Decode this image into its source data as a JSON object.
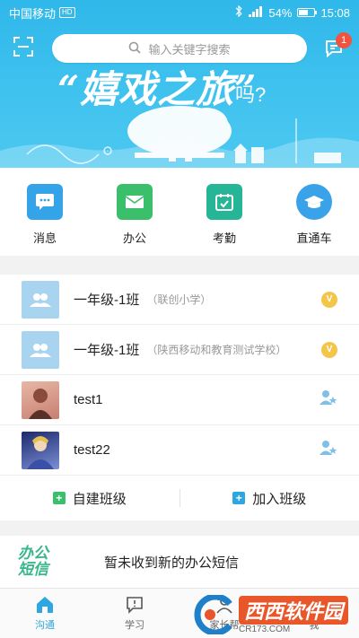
{
  "status_bar": {
    "carrier": "中国移动",
    "hd": "HD",
    "battery": "54%",
    "time": "15:08"
  },
  "header": {
    "search_placeholder": "输入关键字搜索",
    "message_badge": "1"
  },
  "banner": {
    "title": "“嬉戏之旅”",
    "suffix": "吗?"
  },
  "quick_actions": [
    {
      "label": "消息",
      "icon": "chat-icon",
      "color": "#35a3e8"
    },
    {
      "label": "办公",
      "icon": "mail-icon",
      "color": "#3bbf6a"
    },
    {
      "label": "考勤",
      "icon": "calendar-check-icon",
      "color": "#26b597"
    },
    {
      "label": "直通车",
      "icon": "graduation-cap-icon",
      "color": "#3aa2e8"
    }
  ],
  "classes": [
    {
      "name": "一年级-1班",
      "school": "（联创小学）",
      "badge": "V"
    },
    {
      "name": "一年级-1班",
      "school": "（陕西移动和教育测试学校）",
      "badge": "V"
    }
  ],
  "contacts": [
    {
      "name": "test1"
    },
    {
      "name": "test22"
    }
  ],
  "class_actions": {
    "create": "自建班级",
    "join": "加入班级"
  },
  "sms": {
    "logo_line1": "办公",
    "logo_line2": "短信",
    "message": "暂未收到新的办公短信"
  },
  "bottom_nav": [
    {
      "label": "沟通",
      "active": true
    },
    {
      "label": "学习",
      "active": false
    },
    {
      "label": "家长帮",
      "active": false
    },
    {
      "label": "我",
      "active": false
    }
  ],
  "watermark": {
    "title": "西西软件园",
    "url": "CR173.COM"
  },
  "colors": {
    "primary": "#2ea7e0",
    "badge_red": "#f0533f",
    "vip_gold": "#f3c64a",
    "green": "#3bbf6a"
  }
}
